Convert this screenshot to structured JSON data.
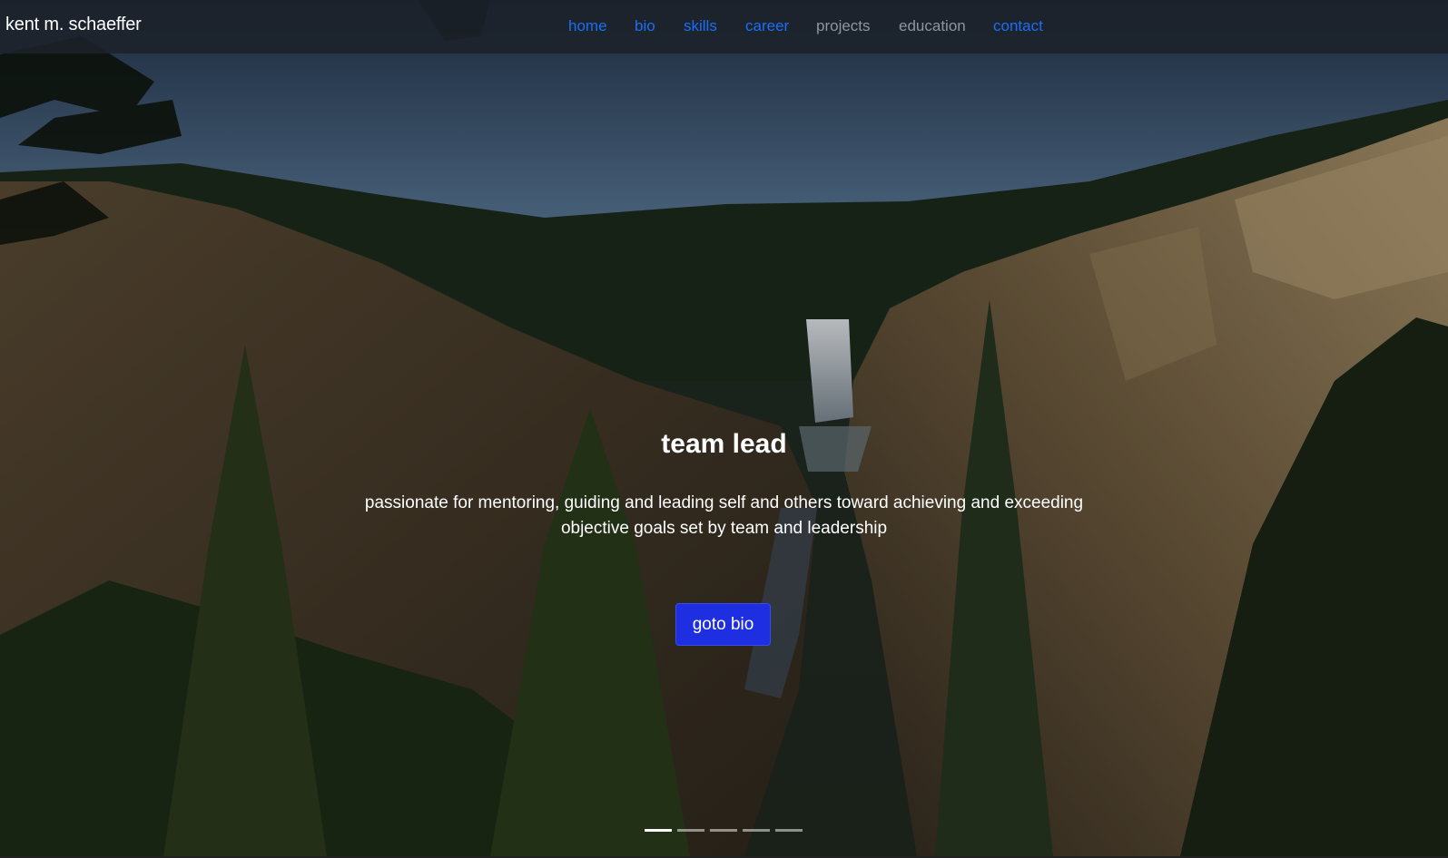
{
  "navbar": {
    "brand": "kent m. schaeffer",
    "links": [
      {
        "label": "home",
        "state": "active"
      },
      {
        "label": "bio",
        "state": "active"
      },
      {
        "label": "skills",
        "state": "active"
      },
      {
        "label": "career",
        "state": "active"
      },
      {
        "label": "projects",
        "state": "muted"
      },
      {
        "label": "education",
        "state": "muted"
      },
      {
        "label": "contact",
        "state": "active"
      }
    ]
  },
  "hero": {
    "title": "team lead",
    "text_line1": "passionate for mentoring, guiding and leading self and others toward achieving and exceeding",
    "text_line2": "objective goals set by team and leadership",
    "button_label": "goto bio",
    "slide_count": 5,
    "active_slide": 1
  },
  "colors": {
    "link_active": "#1a6ef5",
    "link_muted": "#8e959c",
    "button_bg": "#1d2fe0",
    "navbar_bg": "#1c222a"
  }
}
